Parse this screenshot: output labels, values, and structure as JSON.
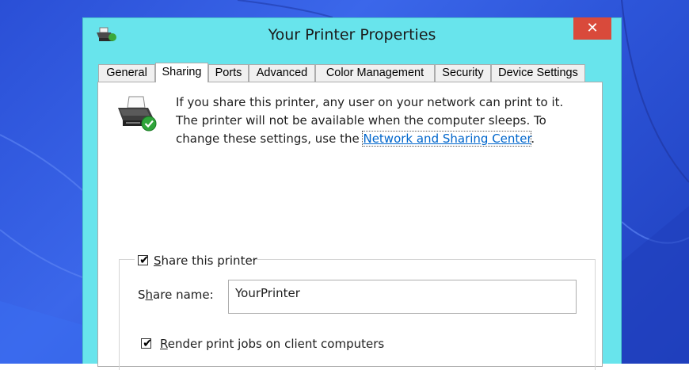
{
  "window": {
    "title": "Your Printer Properties",
    "close_glyph": "✕"
  },
  "tabs": [
    {
      "label": "General"
    },
    {
      "label": "Sharing"
    },
    {
      "label": "Ports"
    },
    {
      "label": "Advanced"
    },
    {
      "label": "Color Management"
    },
    {
      "label": "Security"
    },
    {
      "label": "Device Settings"
    }
  ],
  "active_tab": "Sharing",
  "info": {
    "text_before_link": "If you share this printer, any user on your network can print to it. The printer will not be available when the computer sleeps. To change these settings, use the ",
    "link_text": "Network and Sharing Center",
    "text_after_link": "."
  },
  "share_printer": {
    "checked": true,
    "mnemonic": "S",
    "label_rest": "hare this printer"
  },
  "share_name": {
    "label_start": "S",
    "mnemonic": "h",
    "label_rest": "are name:",
    "value": "YourPrinter"
  },
  "render_jobs": {
    "checked": true,
    "mnemonic": "R",
    "label_rest": "ender print jobs on client computers"
  },
  "colors": {
    "title_bar": "#68e4ec",
    "close_button": "#d94a3b",
    "link": "#0066cc",
    "desktop": "#2a4fd6"
  },
  "icons": [
    "printer-icon",
    "close-icon",
    "checkmark-icon"
  ]
}
